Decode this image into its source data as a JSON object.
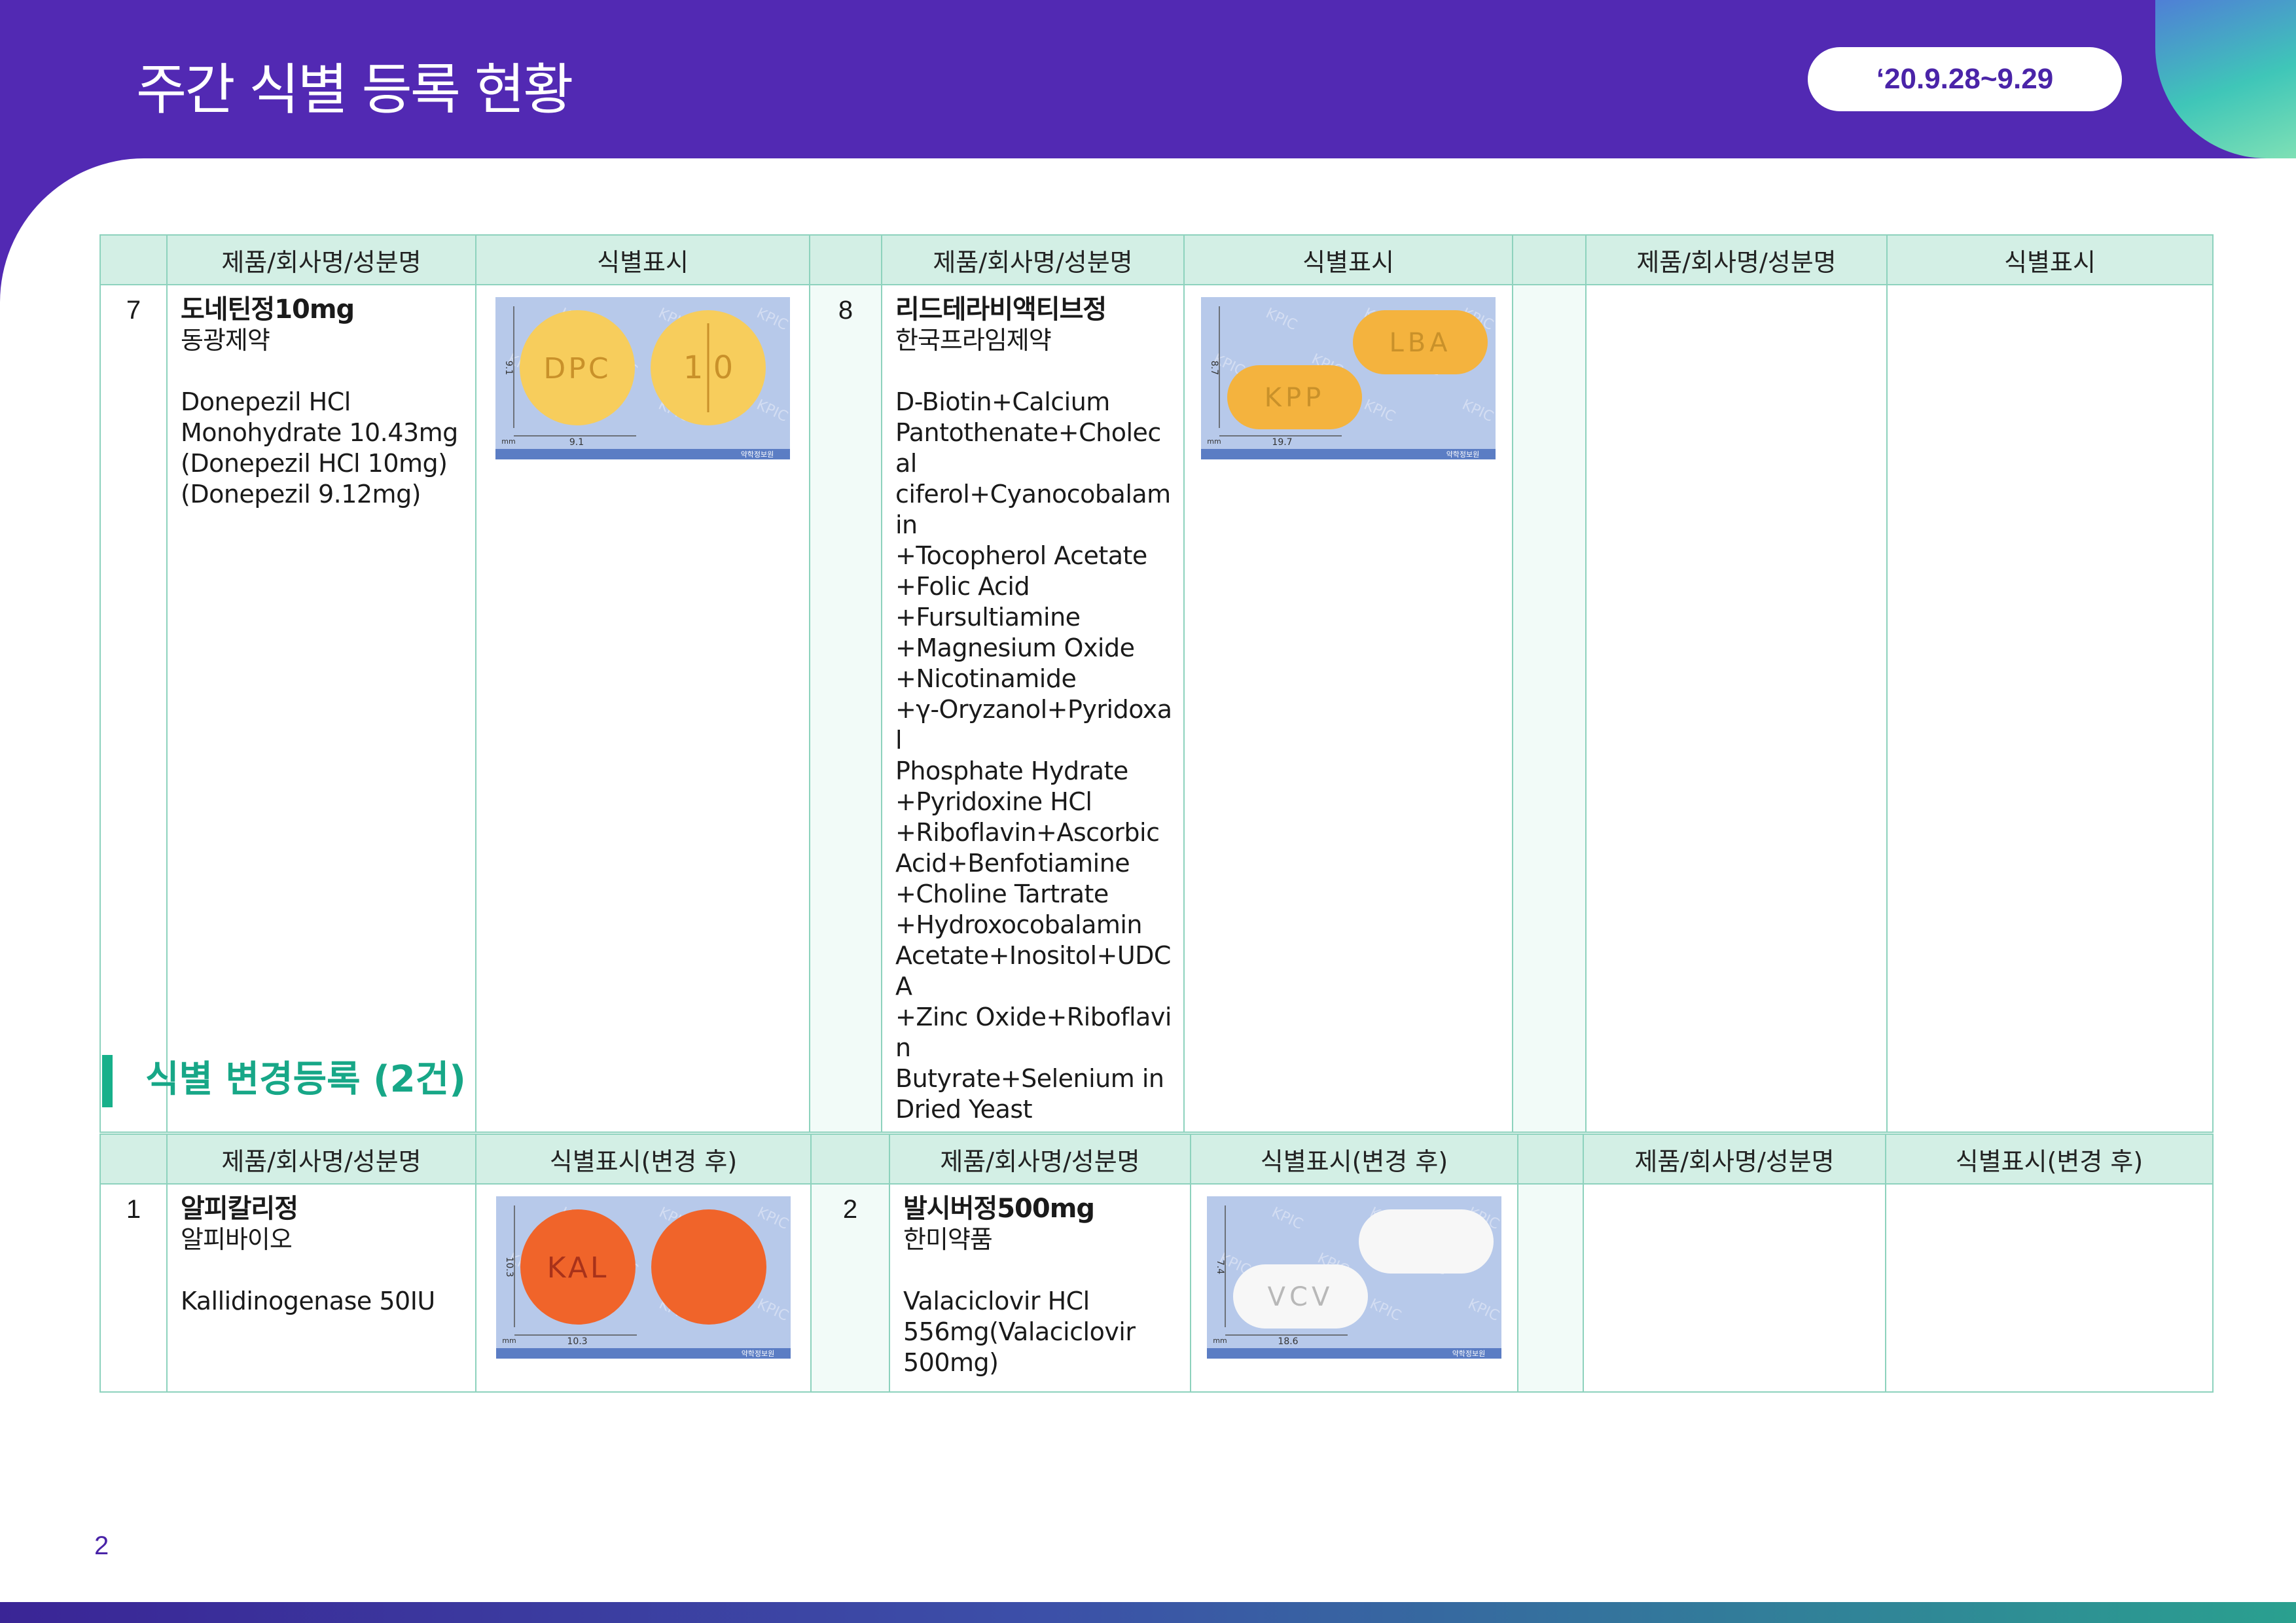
{
  "header": {
    "title": "주간 식별 등록 현황",
    "date": "‘20.9.28~9.29"
  },
  "table1": {
    "headers": [
      "",
      "제품/회사명/성분명",
      "식별표시",
      "",
      "제품/회사명/성분명",
      "식별표시",
      "",
      "제품/회사명/성분명",
      "식별표시"
    ],
    "items": [
      {
        "no": "7",
        "name": "도네틴정10mg",
        "company": "동광제약",
        "ingredients": [
          "Donepezil HCl",
          "Monohydrate 10.43mg",
          "(Donepezil HCl 10mg)",
          "(Donepezil 9.12mg)"
        ],
        "image": {
          "marks": [
            "DPC",
            "1|0"
          ],
          "color": "#f7cd5c",
          "shape": "round",
          "dim_v": "9.1",
          "dim_h": "9.1"
        }
      },
      {
        "no": "8",
        "name": "리드테라비액티브정",
        "company": "한국프라임제약",
        "ingredients": [
          "D-Biotin+Calcium",
          "Pantothenate+Cholecal",
          "ciferol+Cyanocobalamin",
          "+Tocopherol Acetate",
          "+Folic Acid",
          "+Fursultiamine",
          "+Magnesium Oxide",
          "+Nicotinamide",
          "+γ-Oryzanol+Pyridoxal",
          "Phosphate Hydrate",
          "+Pyridoxine HCl",
          "+Riboflavin+Ascorbic",
          "Acid+Benfotiamine",
          "+Choline Tartrate",
          "+Hydroxocobalamin",
          "Acetate+Inositol+UDCA",
          "+Zinc Oxide+Riboflavin",
          "Butyrate+Selenium in",
          "Dried Yeast"
        ],
        "image": {
          "marks": [
            "LBA",
            "KPP"
          ],
          "color": "#f4b33e",
          "shape": "oblong",
          "dim_v": "8.7",
          "dim_h": "19.7"
        }
      }
    ]
  },
  "section": {
    "title": "식별 변경등록 (2건)"
  },
  "table2": {
    "headers": [
      "",
      "제품/회사명/성분명",
      "식별표시(변경 후)",
      "",
      "제품/회사명/성분명",
      "식별표시(변경 후)",
      "",
      "제품/회사명/성분명",
      "식별표시(변경 후)"
    ],
    "items": [
      {
        "no": "1",
        "name": "알피칼리정",
        "company": "알피바이오",
        "ingredients": [
          "Kallidinogenase 50IU"
        ],
        "image": {
          "marks": [
            "KAL",
            ""
          ],
          "color": "#f0642a",
          "shape": "round",
          "dim_v": "10.3",
          "dim_h": "10.3"
        }
      },
      {
        "no": "2",
        "name": "발시버정500mg",
        "company": "한미약품",
        "ingredients": [
          "Valaciclovir HCl",
          "556mg(Valaciclovir",
          "500mg)"
        ],
        "image": {
          "marks": [
            "",
            "VCV"
          ],
          "color": "#f7f7f7",
          "shape": "oblong",
          "dim_v": "7.4",
          "dim_h": "18.6"
        }
      }
    ]
  },
  "image_common": {
    "watermark": "KPIC",
    "unit": "mm",
    "footer": "약학정보원"
  },
  "footer": {
    "page_number": "2"
  }
}
